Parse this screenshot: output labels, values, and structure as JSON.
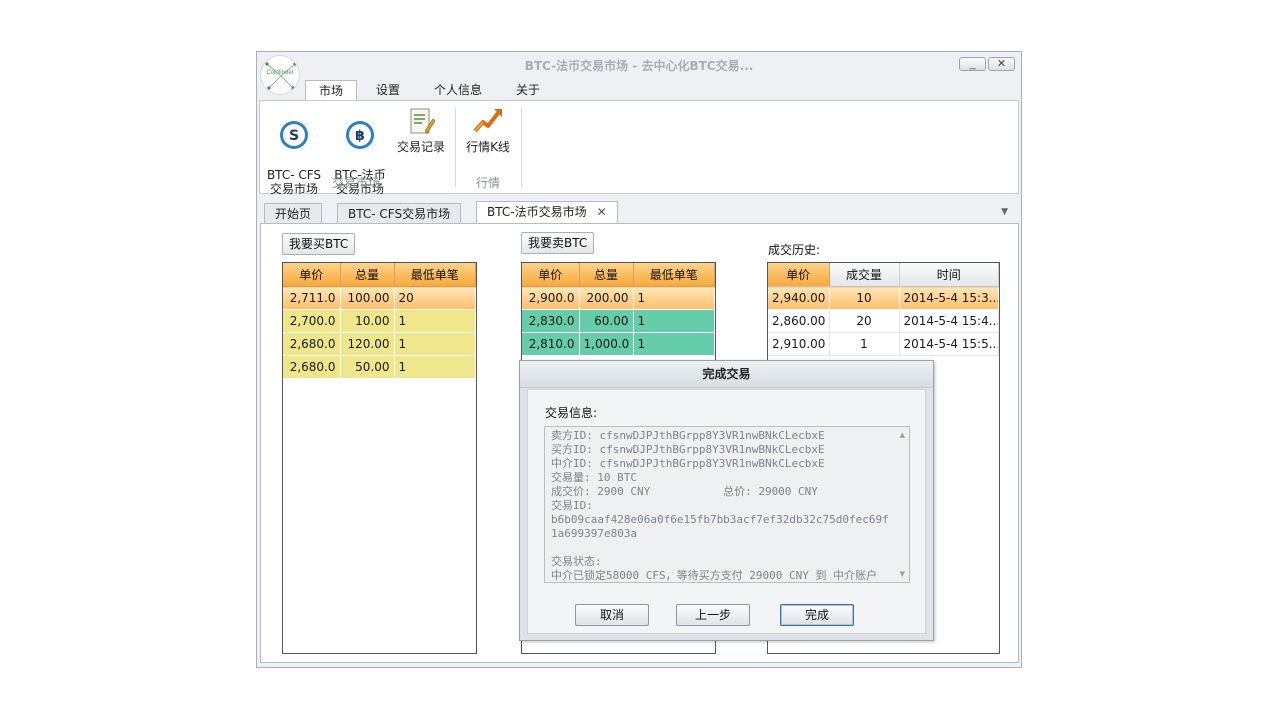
{
  "window": {
    "title": "BTC-法币交易市场 - 去中心化BTC交易...",
    "logo_text": "Coinfinder",
    "minimize": "_",
    "close": "✕"
  },
  "menu_tabs": [
    "市场",
    "设置",
    "个人信息",
    "关于"
  ],
  "ribbon": {
    "groups": [
      {
        "label": "交易市场",
        "buttons": [
          {
            "label": "BTC- CFS\n交易市场",
            "icon": "s-coin-icon"
          },
          {
            "label": "BTC-法币\n交易市场",
            "icon": "bitcoin-icon"
          },
          {
            "label": "交易记录",
            "icon": "document-edit-icon"
          }
        ]
      },
      {
        "label": "行情",
        "buttons": [
          {
            "label": "行情K线",
            "icon": "chart-arrow-icon"
          }
        ]
      }
    ]
  },
  "doc_tabs": [
    "开始页",
    "BTC- CFS交易市场",
    "BTC-法币交易市场"
  ],
  "doc_tab_close": "✕",
  "doc_tab_menu": "▼",
  "buy": {
    "button": "我要买BTC",
    "columns": [
      "单价",
      "总量",
      "最低单笔"
    ],
    "rows": [
      [
        "2,711.0",
        "100.00",
        "20"
      ],
      [
        "2,700.0",
        "10.00",
        "1"
      ],
      [
        "2,680.0",
        "120.00",
        "1"
      ],
      [
        "2,680.0",
        "50.00",
        "1"
      ]
    ]
  },
  "sell": {
    "button": "我要卖BTC",
    "columns": [
      "单价",
      "总量",
      "最低单笔"
    ],
    "rows": [
      [
        "2,900.0",
        "200.00",
        "1"
      ],
      [
        "2,830.0",
        "60.00",
        "1"
      ],
      [
        "2,810.0",
        "1,000.0",
        "1"
      ]
    ]
  },
  "history": {
    "label": "成交历史:",
    "columns": [
      "单价",
      "成交量",
      "时间"
    ],
    "rows": [
      [
        "2,940.00",
        "10",
        "2014-5-4 15:3..."
      ],
      [
        "2,860.00",
        "20",
        "2014-5-4 15:4..."
      ],
      [
        "2,910.00",
        "1",
        "2014-5-4 15:5..."
      ]
    ]
  },
  "dialog": {
    "title": "完成交易",
    "info_label": "交易信息:",
    "info_text": "卖方ID: cfsnwDJPJthBGrpp8Y3VR1nwBNkCLecbxE\n买方ID: cfsnwDJPJthBGrpp8Y3VR1nwBNkCLecbxE\n中介ID: cfsnwDJPJthBGrpp8Y3VR1nwBNkCLecbxE\n交易量: 10 BTC\n成交价: 2900 CNY           总价: 29000 CNY\n交易ID:\nb6b09caaf428e06a0f6e15fb7bb3acf7ef32db32c75d0fec69f1a699397e803a\n\n交易状态:\n中介已锁定58000 CFS，等待买方支付 29000 CNY 到 中介账户",
    "cancel": "取消",
    "prev": "上一步",
    "finish": "完成"
  }
}
